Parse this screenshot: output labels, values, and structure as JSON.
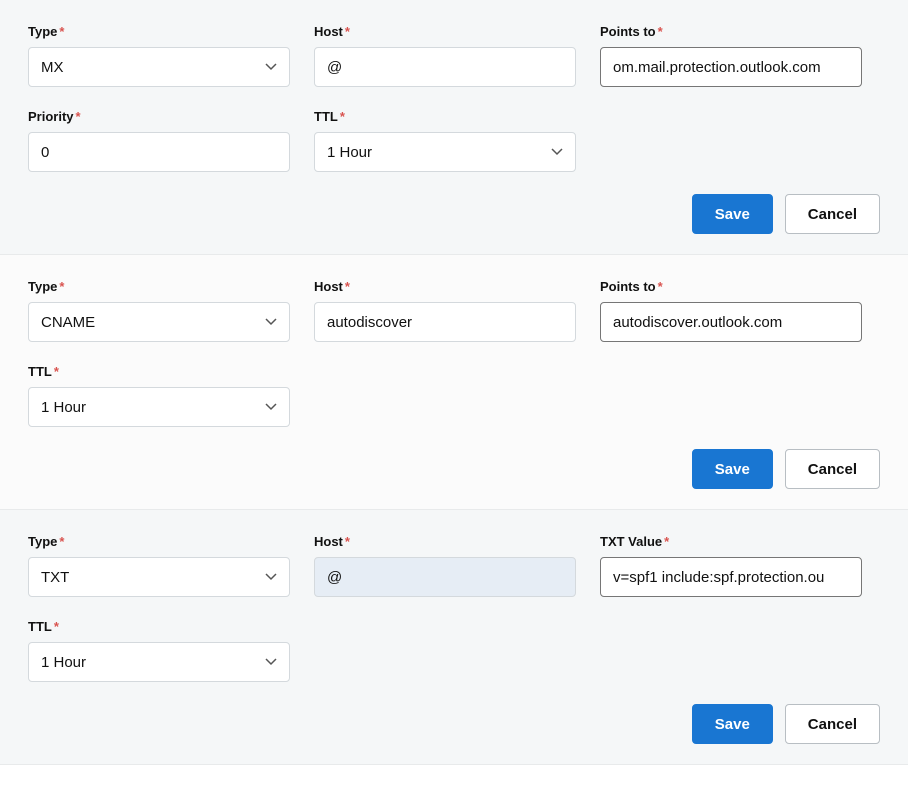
{
  "labels": {
    "type": "Type",
    "host": "Host",
    "points_to": "Points to",
    "priority": "Priority",
    "ttl": "TTL",
    "txt_value": "TXT Value",
    "save": "Save",
    "cancel": "Cancel"
  },
  "records": [
    {
      "type": "MX",
      "host": "@",
      "points_to": "om.mail.protection.outlook.com",
      "priority": "0",
      "ttl": "1 Hour"
    },
    {
      "type": "CNAME",
      "host": "autodiscover",
      "points_to": "autodiscover.outlook.com",
      "ttl": "1 Hour"
    },
    {
      "type": "TXT",
      "host": "@",
      "txt_value": "v=spf1 include:spf.protection.ou",
      "ttl": "1 Hour"
    }
  ]
}
